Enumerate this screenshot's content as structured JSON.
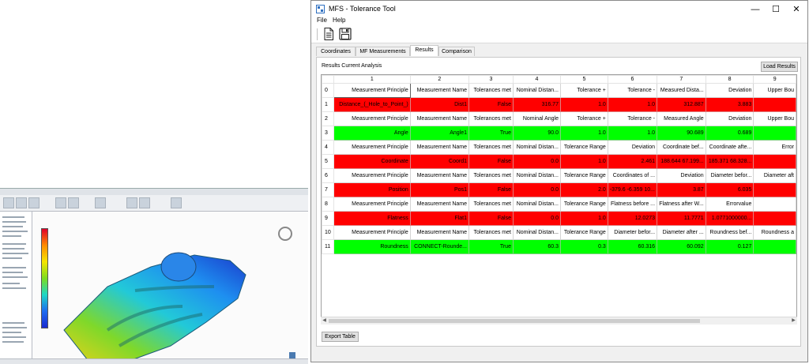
{
  "window": {
    "title": "MFS - Tolerance Tool",
    "minimize_glyph": "—",
    "maximize_glyph": "☐",
    "close_glyph": "✕"
  },
  "menu": [
    "File",
    "Help"
  ],
  "toolbar": {
    "icons": [
      "new-document-icon",
      "save-icon"
    ]
  },
  "tabs": [
    {
      "label": "Coordinates",
      "active": false
    },
    {
      "label": "MF Measurements",
      "active": false
    },
    {
      "label": "Results",
      "active": true
    },
    {
      "label": "Comparison",
      "active": false
    }
  ],
  "results": {
    "section_label": "Results Current Analysis",
    "load_button": "Load Results",
    "export_button": "Export Table",
    "column_headers": [
      "1",
      "2",
      "3",
      "4",
      "5",
      "6",
      "7",
      "8",
      "9"
    ],
    "rows": [
      {
        "index": "0",
        "status": "header",
        "cells": [
          "Measurement Principle",
          "Measurement Name",
          "Tolerances met",
          "Nominal Distan...",
          "Tolerance +",
          "Tolerance -",
          "Measured Dista...",
          "Deviation",
          "Upper Bou"
        ]
      },
      {
        "index": "1",
        "status": "fail",
        "cells": [
          "Distance_(_Hole_to_Point_)",
          "Dist1",
          "False",
          "316.77",
          "1.0",
          "1.0",
          "312.887",
          "3.883",
          ""
        ]
      },
      {
        "index": "2",
        "status": "header",
        "cells": [
          "Measurement Principle",
          "Measurement Name",
          "Tolerances met",
          "Nominal Angle",
          "Tolerance +",
          "Tolerance -",
          "Measured Angle",
          "Deviation",
          "Upper Bou"
        ]
      },
      {
        "index": "3",
        "status": "pass",
        "cells": [
          "Angle",
          "Angle1",
          "True",
          "90.0",
          "1.0",
          "1.0",
          "90.689",
          "0.689",
          ""
        ]
      },
      {
        "index": "4",
        "status": "header",
        "cells": [
          "Measurement Principle",
          "Measurement Name",
          "Tolerances met",
          "Nominal Distan...",
          "Tolerance Range",
          "Deviation",
          "Coordinate bef...",
          "Coordinate afte...",
          "Error"
        ]
      },
      {
        "index": "5",
        "status": "fail",
        "cells": [
          "Coordinate",
          "Coord1",
          "False",
          "0.0",
          "1.0",
          "2.461",
          "188.644 67.199...",
          "185.371 68.328...",
          ""
        ]
      },
      {
        "index": "6",
        "status": "header",
        "cells": [
          "Measurement Principle",
          "Measurement Name",
          "Tolerances met",
          "Nominal Distan...",
          "Tolerance Range",
          "Coordinates of ...",
          "Deviation",
          "Diameter befor...",
          "Diameter aft"
        ]
      },
      {
        "index": "7",
        "status": "fail",
        "cells": [
          "Position",
          "Pos1",
          "False",
          "0.0",
          "2.0",
          "-379.6 -6.359 10...",
          "3.87",
          "6.035",
          ""
        ]
      },
      {
        "index": "8",
        "status": "header",
        "cells": [
          "Measurement Principle",
          "Measurement Name",
          "Tolerances met",
          "Nominal Distan...",
          "Tolerance Range",
          "Flatness before ...",
          "Flatness after W...",
          "Errorvalue",
          ""
        ]
      },
      {
        "index": "9",
        "status": "fail",
        "cells": [
          "Flatness",
          "Flat1",
          "False",
          "0.0",
          "1.0",
          "12.0273",
          "11.7771",
          "1.0771000000...",
          ""
        ]
      },
      {
        "index": "10",
        "status": "header",
        "cells": [
          "Measurement Principle",
          "Measurement Name",
          "Tolerances met",
          "Nominal Distan...",
          "Tolerance Range",
          "Diameter befor...",
          "Diameter after ...",
          "Roundness bef...",
          "Roundness a"
        ]
      },
      {
        "index": "11",
        "status": "pass",
        "cells": [
          "Roundness",
          "CONNECT-Rounde...",
          "True",
          "60.3",
          "0.3",
          "60.316",
          "60.092",
          "0.127",
          ""
        ]
      }
    ]
  },
  "colors": {
    "fail": "#ff0000",
    "pass": "#00ff00",
    "window_bg": "#f0f0f0"
  }
}
